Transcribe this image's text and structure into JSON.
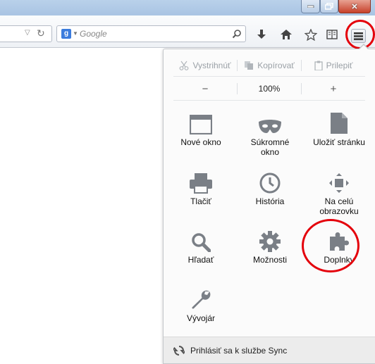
{
  "search": {
    "placeholder": "Google",
    "engine_icon": "google-g-icon",
    "engine_letter": "g"
  },
  "toolbar_icons": [
    "download-arrow-icon",
    "home-icon",
    "bookmark-star-icon",
    "reading-list-icon",
    "hamburger-menu-icon"
  ],
  "edit": {
    "cut": "Vystrihnúť",
    "copy": "Kopírovať",
    "paste": "Prilepiť"
  },
  "zoom": {
    "minus": "−",
    "value": "100%",
    "plus": "+"
  },
  "items": {
    "new_window": "Nové okno",
    "private": "Súkromné\nokno",
    "save_page": "Uložiť stránku",
    "print": "Tlačiť",
    "history": "História",
    "fullscreen": "Na celú\nobrazovku",
    "find": "Hľadať",
    "options": "Možnosti",
    "addons": "Doplnky",
    "developer": "Vývojár"
  },
  "footer": {
    "sync": "Prihlásiť sa k službe Sync"
  },
  "colors": {
    "icon_gray": "#7a7f86",
    "highlight_ring": "#e4000b",
    "close_red": "#c7412a"
  }
}
